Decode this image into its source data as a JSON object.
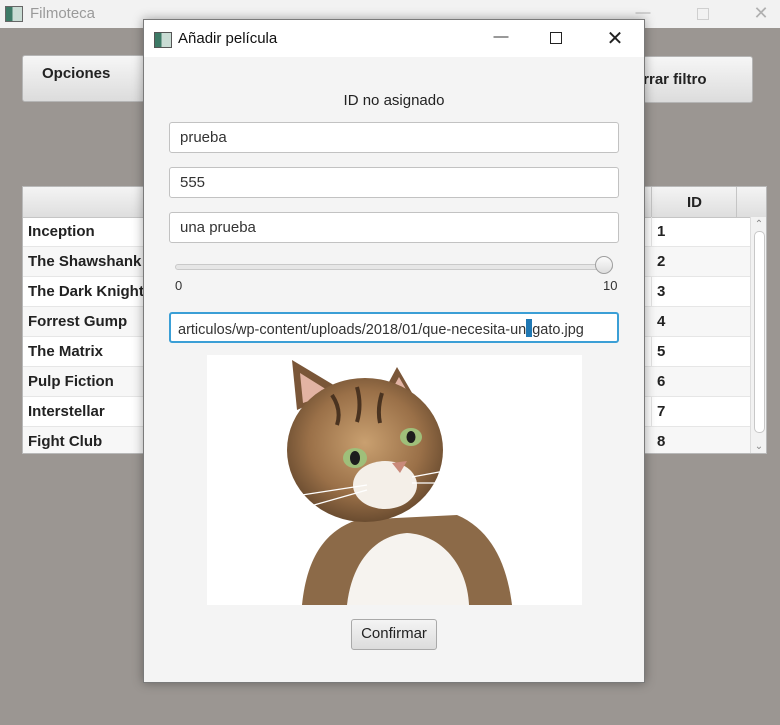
{
  "main_window": {
    "title": "Filmoteca",
    "options_button": "Opciones",
    "filter_button": "orrar filtro",
    "table": {
      "id_header": "ID",
      "rows": [
        {
          "title": "Inception",
          "id": "1"
        },
        {
          "title": "The Shawshank R",
          "id": "2"
        },
        {
          "title": "The Dark Knight",
          "id": "3"
        },
        {
          "title": "Forrest Gump",
          "id": "4"
        },
        {
          "title": "The Matrix",
          "id": "5"
        },
        {
          "title": "Pulp Fiction",
          "id": "6"
        },
        {
          "title": "Interstellar",
          "id": "7"
        },
        {
          "title": "Fight Club",
          "id": "8"
        }
      ]
    }
  },
  "dialog": {
    "title": "Añadir película",
    "id_label": "ID no asignado",
    "fields": {
      "title_value": "prueba",
      "year_value": "555",
      "description_value": "una prueba",
      "image_url_before": "articulos/wp-content/uploads/2018/01/que-necesita-un",
      "image_url_after": "gato.jpg"
    },
    "rating": {
      "min": "0",
      "max": "10",
      "value": 10
    },
    "image": "cat-photo",
    "confirm_button": "Confirmar"
  },
  "colors": {
    "backdrop": "#9b9692",
    "focus": "#3b9fd6"
  }
}
